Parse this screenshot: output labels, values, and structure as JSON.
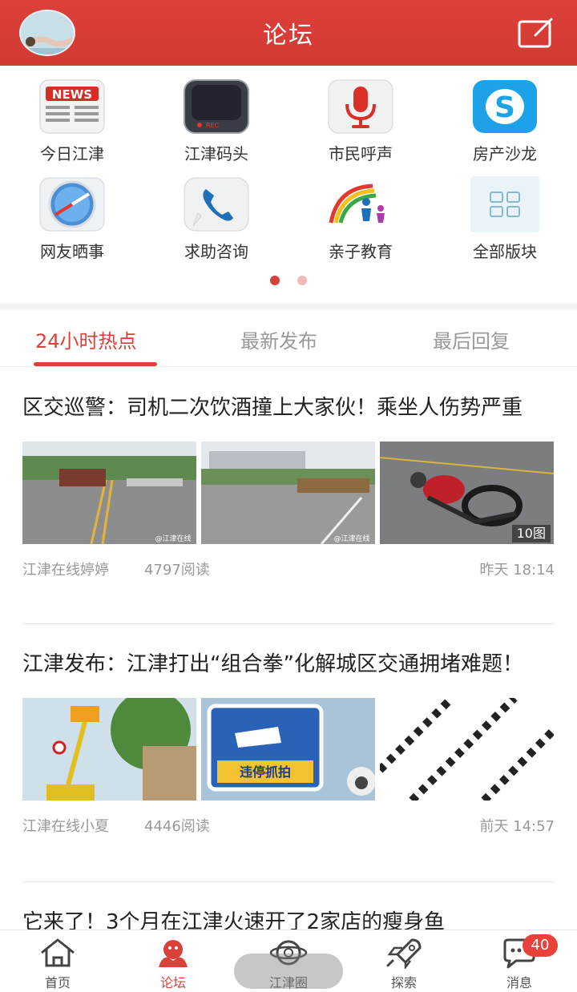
{
  "header": {
    "title": "论坛"
  },
  "sections": [
    {
      "label": "今日江津",
      "icon": "news-icon"
    },
    {
      "label": "江津码头",
      "icon": "rec-icon"
    },
    {
      "label": "市民呼声",
      "icon": "microphone-icon"
    },
    {
      "label": "房产沙龙",
      "icon": "skype-icon"
    },
    {
      "label": "网友晒事",
      "icon": "compass-icon"
    },
    {
      "label": "求助咨询",
      "icon": "phone-icon"
    },
    {
      "label": "亲子教育",
      "icon": "family-rainbow-icon"
    },
    {
      "label": "全部版块",
      "icon": "grid-icon"
    }
  ],
  "pager": {
    "pages": 2,
    "current": 1
  },
  "tabs": [
    {
      "label": "24小时热点",
      "active": true
    },
    {
      "label": "最新发布",
      "active": false
    },
    {
      "label": "最后回复",
      "active": false
    }
  ],
  "posts": [
    {
      "title": "区交巡警：司机二次饮酒撞上大家伙！乘坐人伤势严重",
      "author": "江津在线婷婷",
      "reads": "4797阅读",
      "time": "昨天 18:14",
      "image_count": "10图",
      "watermark": "@江津在线"
    },
    {
      "title": "江津发布：江津打出“组合拳”化解城区交通拥堵难题！",
      "author": "江津在线小夏",
      "reads": "4446阅读",
      "time": "前天 14:57",
      "sign_text": "违停抓拍"
    },
    {
      "title": "它来了！3个月在江津火速开了2家店的瘦身鱼"
    }
  ],
  "nav": [
    {
      "label": "首页",
      "icon": "home-icon"
    },
    {
      "label": "论坛",
      "icon": "forum-icon",
      "active": true
    },
    {
      "label": "江津圈",
      "icon": "planet-icon"
    },
    {
      "label": "探索",
      "icon": "rocket-icon"
    },
    {
      "label": "消息",
      "icon": "message-icon",
      "badge": "40"
    }
  ],
  "colors": {
    "brand": "#d9413a",
    "header": "#d7403a",
    "muted": "#999999"
  }
}
